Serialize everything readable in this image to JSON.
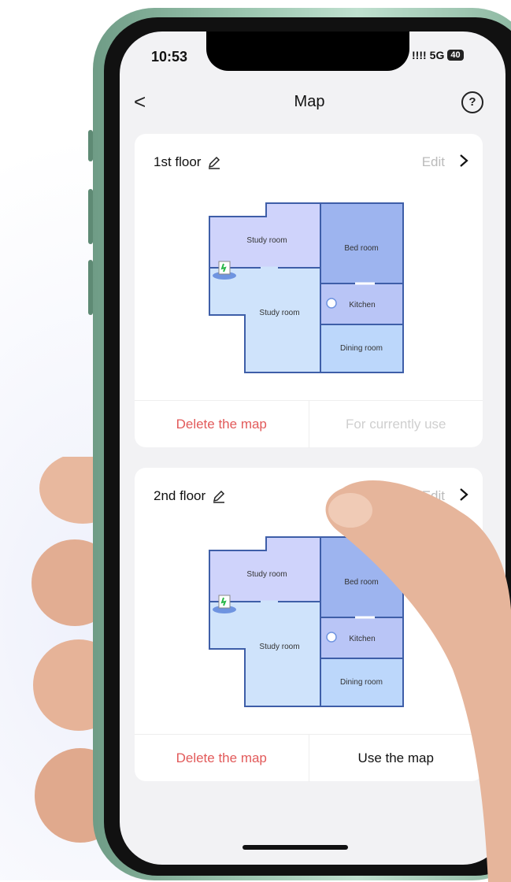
{
  "status": {
    "time": "10:53",
    "signal": "!!!!",
    "network": "5G",
    "battery": "40"
  },
  "header": {
    "title": "Map",
    "back": "<",
    "help": "?"
  },
  "cards": [
    {
      "title": "1st floor",
      "edit": "Edit",
      "rooms": {
        "study_top": "Study room",
        "study_bottom": "Study room",
        "bed": "Bed room",
        "kitchen": "Kitchen",
        "dining": "Dining room"
      },
      "delete": "Delete the map",
      "action": "For currently use"
    },
    {
      "title": "2nd floor",
      "edit": "Edit",
      "rooms": {
        "study_top": "Study room",
        "study_bottom": "Study room",
        "bed": "Bed room",
        "kitchen": "Kitchen",
        "dining": "Dining room"
      },
      "delete": "Delete the map",
      "action": "Use the map"
    }
  ],
  "colors": {
    "danger": "#e25a5a",
    "disabled": "#cfcfcf",
    "room_light": "#cfe3fb",
    "room_mid": "#b9c5f6",
    "room_dark": "#9db4ef",
    "wall": "#3e5ea8",
    "phone_frame": "#9cc6b0"
  }
}
